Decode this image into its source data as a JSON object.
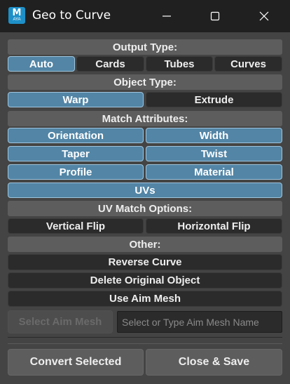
{
  "window": {
    "title": "Geo to Curve",
    "icon_letter": "M",
    "icon_sub": "AYA"
  },
  "output_type": {
    "header": "Output Type:",
    "options": [
      "Auto",
      "Cards",
      "Tubes",
      "Curves"
    ],
    "selected": "Auto"
  },
  "object_type": {
    "header": "Object Type:",
    "options": [
      "Warp",
      "Extrude"
    ],
    "selected": "Warp"
  },
  "match_attributes": {
    "header": "Match Attributes:",
    "options": [
      "Orientation",
      "Width",
      "Taper",
      "Twist",
      "Profile",
      "Material",
      "UVs"
    ]
  },
  "uv_match": {
    "header": "UV Match Options:",
    "options": [
      "Vertical Flip",
      "Horizontal Flip"
    ]
  },
  "other": {
    "header": "Other:",
    "reverse_curve": "Reverse Curve",
    "delete_original": "Delete Original Object",
    "use_aim_mesh": "Use Aim Mesh",
    "select_aim_mesh": "Select Aim Mesh",
    "aim_mesh_placeholder": "Select or Type Aim Mesh Name"
  },
  "footer": {
    "convert": "Convert Selected",
    "close_save": "Close & Save"
  },
  "colors": {
    "selected": "#5285a6",
    "button": "#2b2b2b",
    "header": "#5d5d5d",
    "background": "#444444",
    "titlebar": "#202020"
  }
}
